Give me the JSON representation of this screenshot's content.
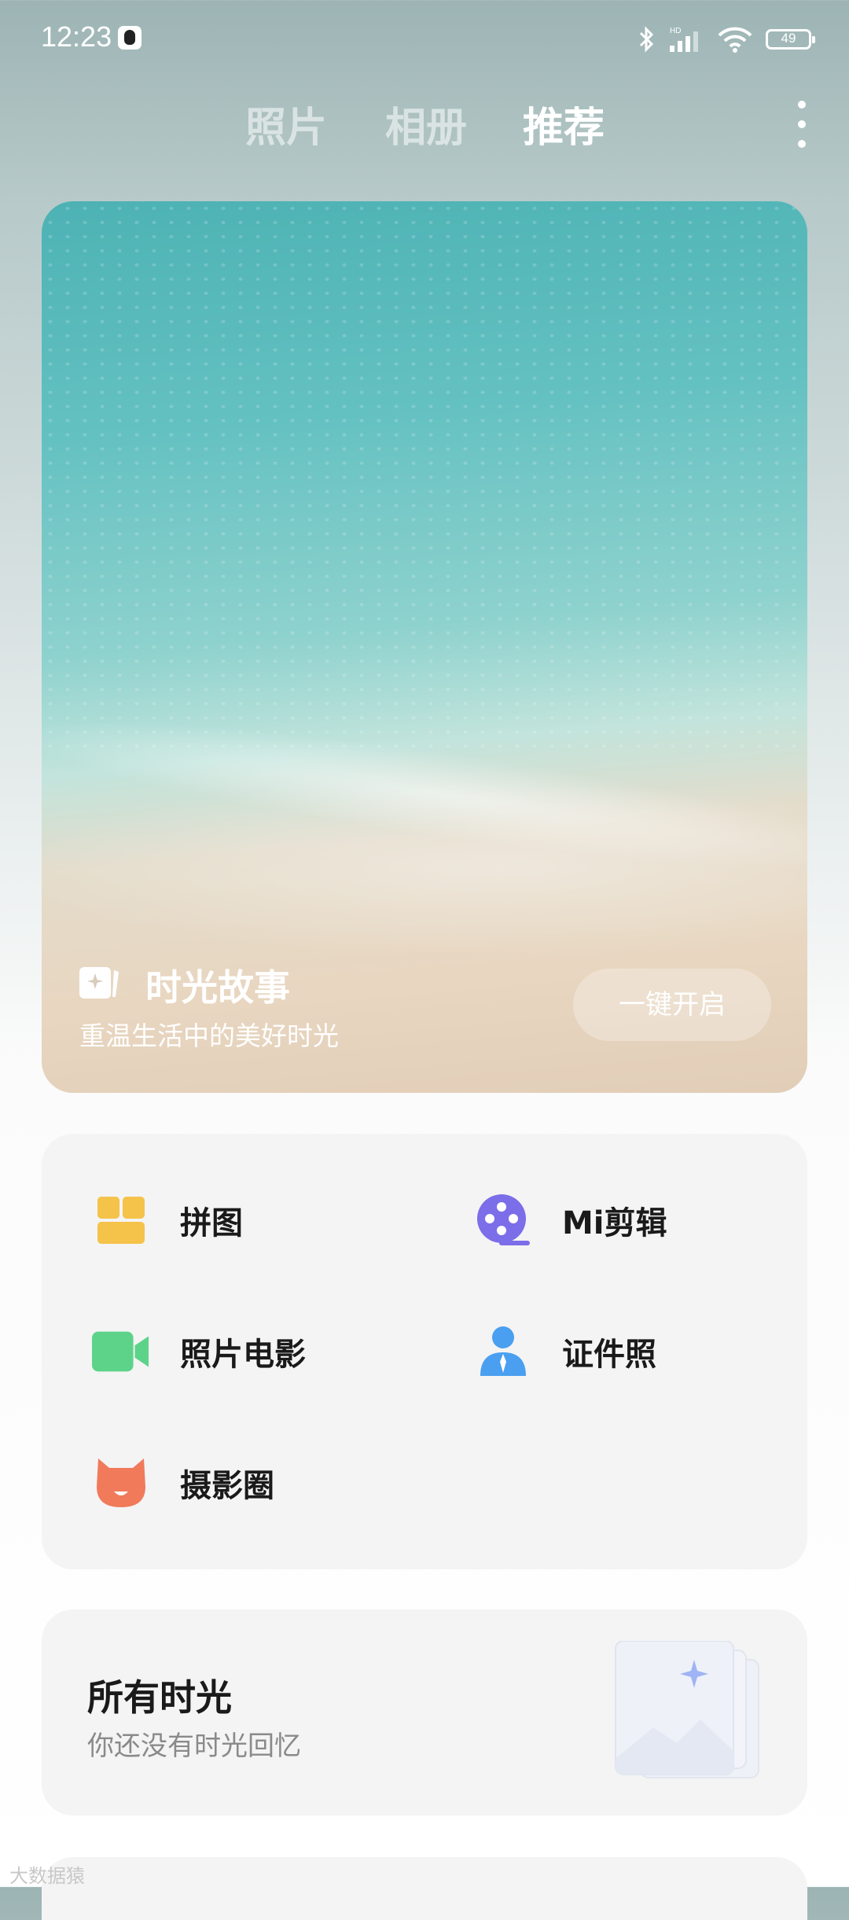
{
  "status_bar": {
    "time": "12:23",
    "battery": "49"
  },
  "tabs": [
    {
      "label": "照片",
      "active": false
    },
    {
      "label": "相册",
      "active": false
    },
    {
      "label": "推荐",
      "active": true
    }
  ],
  "hero": {
    "title": "时光故事",
    "subtitle": "重温生活中的美好时光",
    "button_label": "一键开启"
  },
  "tools": [
    {
      "label": "拼图",
      "icon": "collage-icon",
      "color": "#f5c24a"
    },
    {
      "label": "Mi剪辑",
      "icon": "film-reel-icon",
      "color": "#7b6ee8"
    },
    {
      "label": "照片电影",
      "icon": "video-camera-icon",
      "color": "#5dd38a"
    },
    {
      "label": "证件照",
      "icon": "id-photo-person-icon",
      "color": "#4a9ff0"
    },
    {
      "label": "摄影圈",
      "icon": "mi-bunny-icon",
      "color": "#f07a5a"
    }
  ],
  "moments": {
    "title": "所有时光",
    "subtitle": "你还没有时光回忆"
  },
  "watermark": "大数据猿"
}
